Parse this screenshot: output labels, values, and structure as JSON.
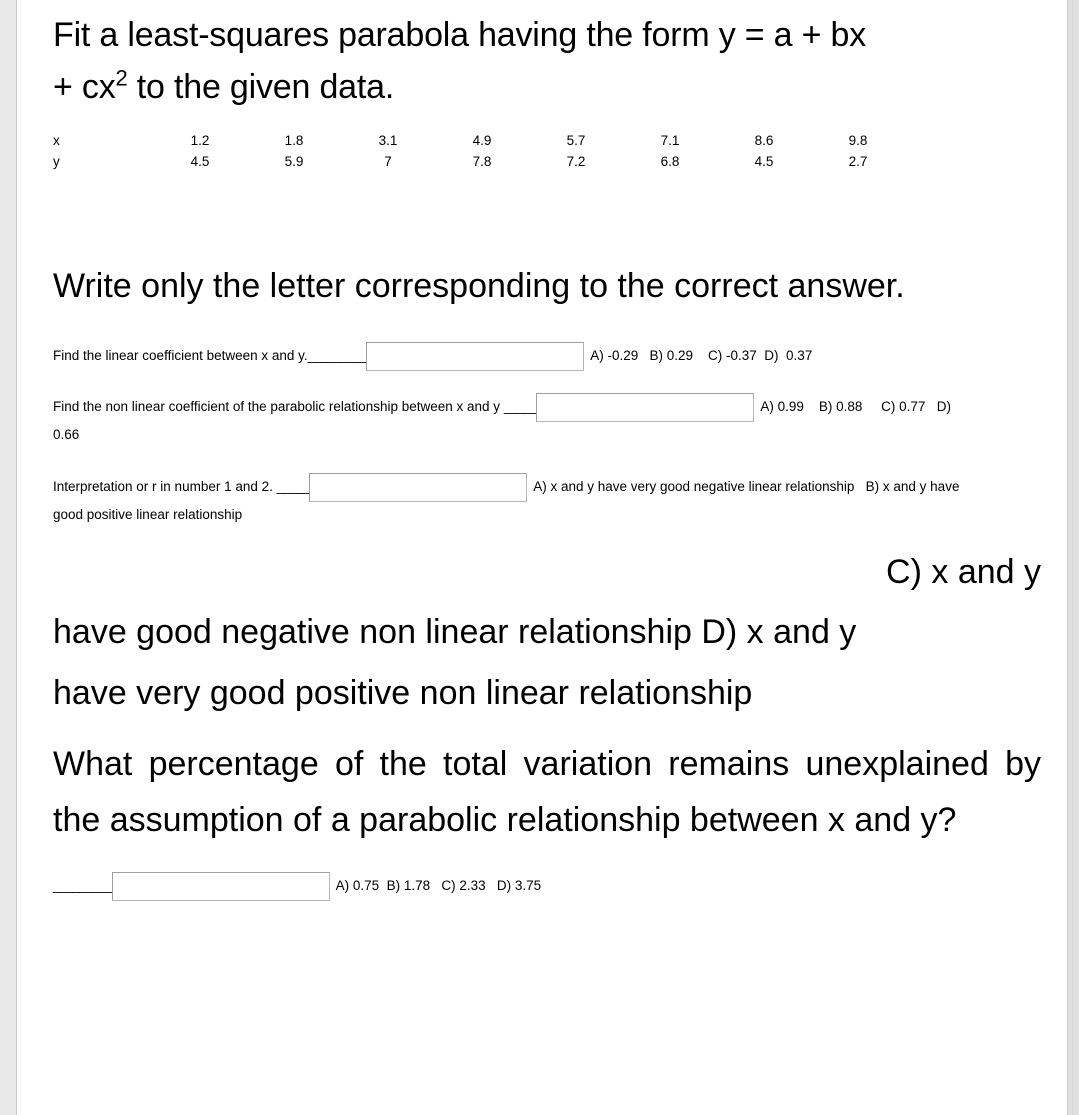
{
  "document": {
    "heading": {
      "line1": "Fit a least-squares parabola having the form  y = a + bx",
      "line2_pre": "+ cx",
      "line2_sup": "2",
      "line2_post": " to the given data."
    },
    "data_table": {
      "x_label": "x",
      "y_label": "y",
      "x_values": [
        "1.2",
        "1.8",
        "3.1",
        "4.9",
        "5.7",
        "7.1",
        "8.6",
        "9.8"
      ],
      "y_values": [
        "4.5",
        "5.9",
        "7",
        "7.8",
        "7.2",
        "6.8",
        "4.5",
        "2.7"
      ]
    },
    "instruction": "Write only the letter corresponding to the correct answer.",
    "questions": [
      {
        "prompt": "Find the linear coefficient between x and y.",
        "blank": "_________",
        "input_value": "",
        "options": "A) -0.29   B) 0.29    C) -0.37  D)  0.37"
      },
      {
        "prompt": "Find the non linear coefficient of the parabolic relationship between x and y",
        "blank": "_____",
        "input_value": "",
        "options": "A) 0.99    B) 0.88     C) 0.77   D)",
        "options_wrap": "0.66"
      },
      {
        "prompt": "Interpretation or r in number 1 and 2.",
        "blank": "_____",
        "input_value": "",
        "options": "A) x and y have very good negative linear relationship   B) x and y have",
        "options_wrap": "good positive linear relationship",
        "options_large_right": "C) x and y",
        "options_large_line2": "have good negative non linear relationship   D) x and y",
        "options_large_line3": "have very good positive non linear relationship"
      },
      {
        "prompt": "What percentage of the total variation remains unexplained by the assumption of a parabolic relationship between x and y?",
        "blank": "_________",
        "input_value": "",
        "options": "A) 0.75  B) 1.78   C) 2.33   D) 3.75"
      }
    ]
  },
  "colors": {
    "page_background": "#ffffff",
    "gutter": "#e9e9e9",
    "text": "#000000",
    "input_border": "#9e9e9e"
  }
}
